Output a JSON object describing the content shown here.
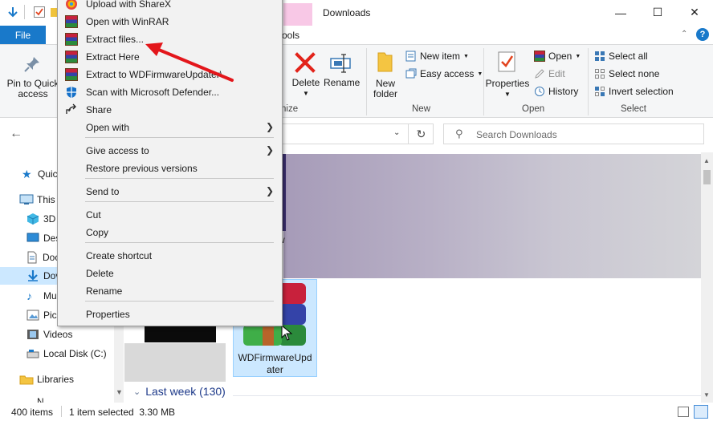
{
  "window": {
    "title": "Downloads",
    "minimize": "—",
    "maximize": "☐",
    "close": "✕"
  },
  "ribbon_tabs": {
    "file": "File",
    "tools_fragment": "ools"
  },
  "ribbon": {
    "pin_line1": "Pin to Quick",
    "pin_line2": "access",
    "delete": "Delete",
    "rename": "Rename",
    "organize_fragment": "nize",
    "new_item": "New item",
    "easy_access": "Easy access",
    "new_folder_line1": "New",
    "new_folder_line2": "folder",
    "new_group": "New",
    "properties": "Properties",
    "open": "Open",
    "edit": "Edit",
    "history": "History",
    "open_group": "Open",
    "select_all": "Select all",
    "select_none": "Select none",
    "invert_selection": "Invert selection",
    "select_group": "Select"
  },
  "address": {
    "search_placeholder": "Search Downloads"
  },
  "nav": [
    {
      "label": "Quic",
      "icon": "star-icon"
    },
    {
      "label": "This",
      "icon": "pc-icon"
    },
    {
      "label": "3D",
      "icon": "cube-icon"
    },
    {
      "label": "Des",
      "icon": "desktop-icon"
    },
    {
      "label": "Doc",
      "icon": "document-icon"
    },
    {
      "label": "Dov",
      "icon": "download-icon"
    },
    {
      "label": "Mu",
      "icon": "music-icon"
    },
    {
      "label": "Pic",
      "icon": "pictures-icon"
    },
    {
      "label": "Videos",
      "icon": "video-icon"
    },
    {
      "label": "Local Disk (C:)",
      "icon": "disk-icon"
    },
    {
      "label": "Libraries",
      "icon": "libraries-icon"
    },
    {
      "label": "N",
      "icon": "network-icon"
    }
  ],
  "content": {
    "selected_file_line1": "WDFirmwareUpd",
    "selected_file_line2": "ater",
    "group_header": "Last week (130)",
    "peek_w": "w",
    "peek_s": "s"
  },
  "status": {
    "items": "400 items",
    "selected": "1 item selected  3.30 MB"
  },
  "context_menu": {
    "upload_sharex": "Upload with ShareX",
    "open_winrar": "Open with WinRAR",
    "extract_files": "Extract files...",
    "extract_here": "Extract Here",
    "extract_to": "Extract to WDFirmwareUpdater\\",
    "scan_defender": "Scan with Microsoft Defender...",
    "share": "Share",
    "open_with": "Open with",
    "give_access": "Give access to",
    "restore_versions": "Restore previous versions",
    "send_to": "Send to",
    "cut": "Cut",
    "copy": "Copy",
    "create_shortcut": "Create shortcut",
    "delete": "Delete",
    "rename": "Rename",
    "properties": "Properties"
  },
  "colors": {
    "file_tab": "#1979ca",
    "selection": "#cce8ff",
    "annotation_arrow": "#e3161b",
    "context_tab": "#f8c8e6"
  }
}
